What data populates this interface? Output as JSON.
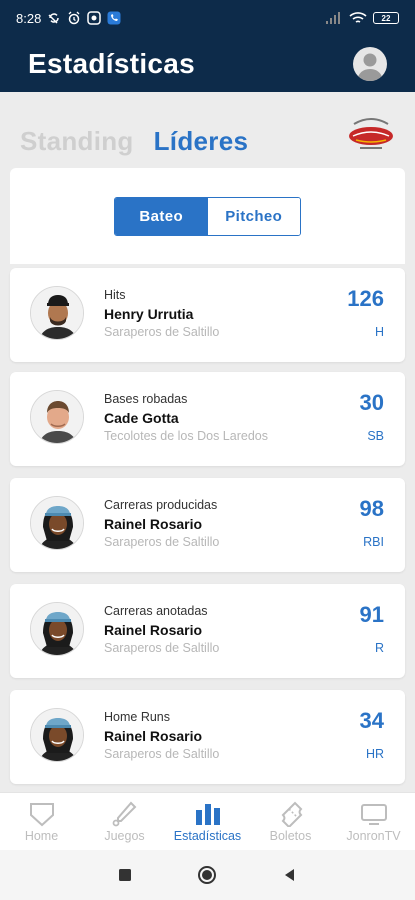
{
  "status_bar": {
    "time": "8:28",
    "battery": "22"
  },
  "header": {
    "title": "Estadísticas"
  },
  "tabs": [
    {
      "label": "Standing",
      "active": false
    },
    {
      "label": "Líderes",
      "active": true
    }
  ],
  "segment": {
    "batting_label": "Bateo",
    "pitching_label": "Pitcheo",
    "selected": "Bateo"
  },
  "leaders": [
    {
      "stat": "Hits",
      "player": "Henry Urrutia",
      "team": "Saraperos de Saltillo",
      "value": "126",
      "abbr": "H"
    },
    {
      "stat": "Bases robadas",
      "player": "Cade Gotta",
      "team": "Tecolotes de los Dos Laredos",
      "value": "30",
      "abbr": "SB"
    },
    {
      "stat": "Carreras producidas",
      "player": "Rainel Rosario",
      "team": "Saraperos de Saltillo",
      "value": "98",
      "abbr": "RBI"
    },
    {
      "stat": "Carreras anotadas",
      "player": "Rainel Rosario",
      "team": "Saraperos de Saltillo",
      "value": "91",
      "abbr": "R"
    },
    {
      "stat": "Home Runs",
      "player": "Rainel Rosario",
      "team": "Saraperos de Saltillo",
      "value": "34",
      "abbr": "HR"
    }
  ],
  "bottom_nav": [
    {
      "label": "Home",
      "icon": "home-plate-icon",
      "active": false
    },
    {
      "label": "Juegos",
      "icon": "bat-icon",
      "active": false
    },
    {
      "label": "Estadísticas",
      "icon": "bar-chart-icon",
      "active": true
    },
    {
      "label": "Boletos",
      "icon": "ticket-icon",
      "active": false
    },
    {
      "label": "JonronTV",
      "icon": "tv-icon",
      "active": false
    }
  ],
  "colors": {
    "header_bg": "#0d2b4a",
    "accent": "#2a73c6",
    "inactive": "#bdbdbd"
  }
}
